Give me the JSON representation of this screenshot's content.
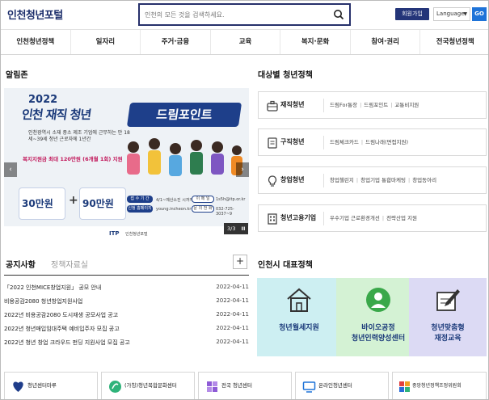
{
  "header": {
    "logo": "인천청년포털",
    "search_placeholder": "인천의 모든 것을 검색하세요.",
    "join_label": "회원가입",
    "language_label": "Language",
    "go_label": "GO"
  },
  "nav": [
    "인천청년정책",
    "일자리",
    "주거·금융",
    "교육",
    "복지·문화",
    "참여·권리",
    "전국청년정책"
  ],
  "notice_board": {
    "title": "알림존",
    "banner": {
      "year": "2022",
      "headline": "인천 재직 청년",
      "pill": "드림포인트",
      "desc": "인천광역시 소재 중소 제조 기업에 근무하는 만 18세~39세 청년 근로자에 1년간",
      "highlight": "복지지원금 최대 120만원 (6개월 1회) 지원",
      "amount1": "30만원",
      "amount2": "90만원",
      "counter": "3/3",
      "pause": "II",
      "prev": "‹",
      "next": "›",
      "org": "ITP",
      "org2": "인천청년포털",
      "site": "young.incheon.kr",
      "phone": "032-725-3037~9",
      "email": "1s5h@itp.or.kr",
      "period": "4/1~예산소진 시까지",
      "period_label": "접 수 기 간",
      "site_label": "신청 홈페이지",
      "email_label": "이 메 일",
      "phone_label": "문 의 전 화"
    },
    "tabs": {
      "active": "공지사항",
      "inactive": "정책자료실",
      "plus": "+"
    },
    "items": [
      {
        "title": "「2022 인천MICE창업지원」 공모 안내",
        "date": "2022-04-11"
      },
      {
        "title": "비용공감2080 청년창업지원사업",
        "date": "2022-04-11"
      },
      {
        "title": "2022년 비용공감2080 도시재생 공모사업 공고",
        "date": "2022-04-11"
      },
      {
        "title": "2022년 청년매입임대주택 예비입주자 모집 공고",
        "date": "2022-04-11"
      },
      {
        "title": "2022년 청년 창업 크라우드 펀딩 지원사업 모집 공고",
        "date": "2022-04-11"
      }
    ]
  },
  "target_policy": {
    "title": "대상별 청년정책",
    "rows": [
      {
        "icon": "briefcase-icon",
        "name": "재직청년",
        "links": [
          "드림For통장",
          "드림포인트",
          "교통비지원"
        ]
      },
      {
        "icon": "document-icon",
        "name": "구직청년",
        "links": [
          "드림체크카드",
          "드림나래(면접지원)"
        ]
      },
      {
        "icon": "lightbulb-icon",
        "name": "창업청년",
        "links": [
          "창업챌린지",
          "창업기업 통합마케팅",
          "창업동아리"
        ]
      },
      {
        "icon": "building-icon",
        "name": "청년고용기업",
        "links": [
          "우수기업 근로환경개선",
          "전략산업 지원"
        ]
      }
    ]
  },
  "representative": {
    "title": "인천시 대표정책",
    "cards": [
      {
        "icon": "house-icon",
        "label1": "청년월세지원",
        "label2": "",
        "color": "#cdeff2"
      },
      {
        "icon": "person-badge-icon",
        "label1": "바이오공정",
        "label2": "청년인력양성센터",
        "color": "#d4f2d4"
      },
      {
        "icon": "pen-notepad-icon",
        "label1": "청년맞춤형",
        "label2": "재정교육",
        "color": "#dcdaf4"
      }
    ]
  },
  "bottom_links": [
    {
      "icon": "heart-icon",
      "label": "청년센터마루"
    },
    {
      "icon": "leaf-icon",
      "label": "(가칭)청년복합문화센터"
    },
    {
      "icon": "puzzle-icon",
      "label": "전국 청년센터"
    },
    {
      "icon": "monitor-icon",
      "label": "온라인청년센터"
    },
    {
      "icon": "grid-icon",
      "label": "중앙청년정책조정위원회"
    }
  ],
  "colors": {
    "primary": "#243579",
    "go": "#1e73d8",
    "pink": "#c2185b"
  }
}
